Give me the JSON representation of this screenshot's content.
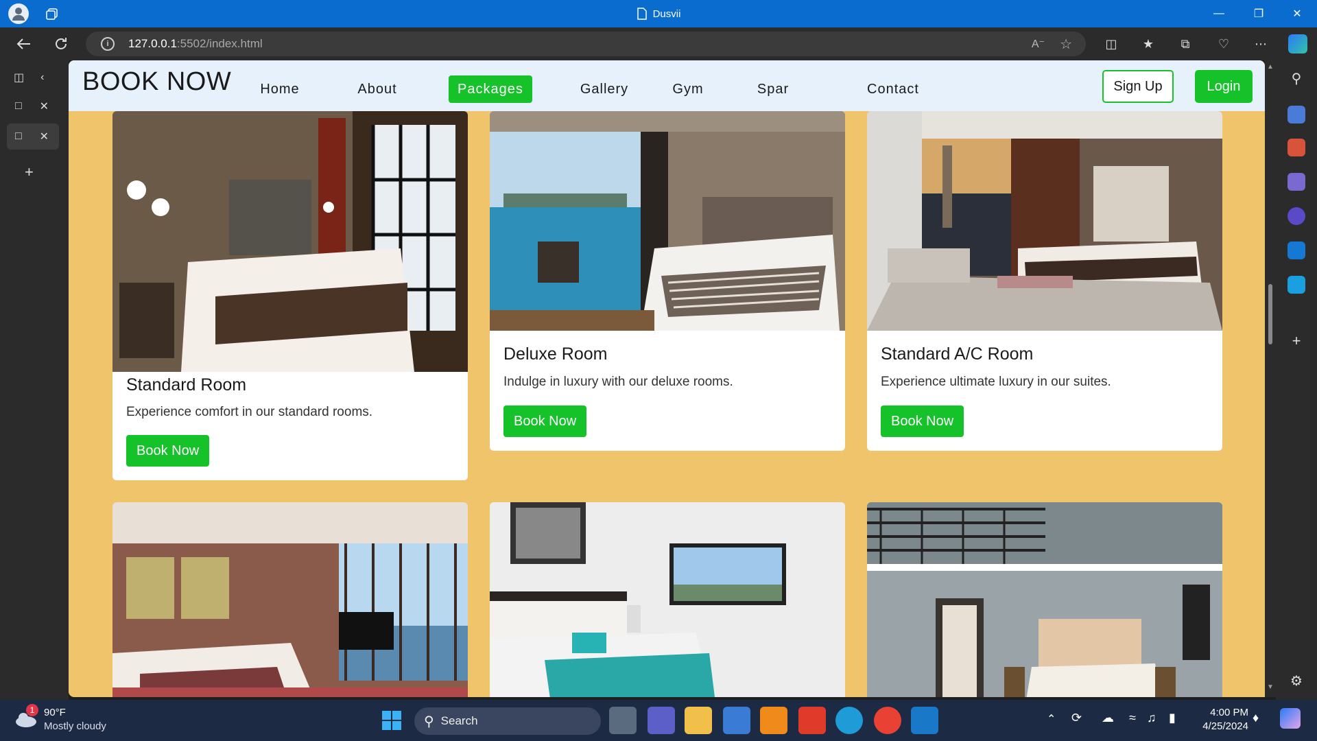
{
  "window": {
    "title": "Dusvii"
  },
  "browser": {
    "url_host": "127.0.0.1",
    "url_path": ":5502/index.html"
  },
  "site": {
    "brand": "BOOK NOW",
    "nav": [
      {
        "label": "Home"
      },
      {
        "label": "About"
      },
      {
        "label": "Packages",
        "active": true
      },
      {
        "label": "Gallery"
      },
      {
        "label": "Gym"
      },
      {
        "label": "Spar"
      },
      {
        "label": "Contact"
      }
    ],
    "signup_label": "Sign Up",
    "login_label": "Login"
  },
  "cards": [
    {
      "title": "Standard Room",
      "description": "Experience comfort in our standard rooms.",
      "button": "Book Now"
    },
    {
      "title": "Deluxe Room",
      "description": "Indulge in luxury with our deluxe rooms.",
      "button": "Book Now"
    },
    {
      "title": "Standard A/C Room",
      "description": "Experience ultimate luxury in our suites.",
      "button": "Book Now"
    }
  ],
  "taskbar": {
    "weather_temp": "90°F",
    "weather_desc": "Mostly cloudy",
    "weather_badge": "1",
    "search_label": "Search",
    "time": "4:00 PM",
    "date": "4/25/2024"
  },
  "colors": {
    "page_bg": "#efc46b",
    "accent_green": "#16c22a",
    "nav_bg": "#e7f1fb",
    "titlebar": "#0a6ccf"
  }
}
